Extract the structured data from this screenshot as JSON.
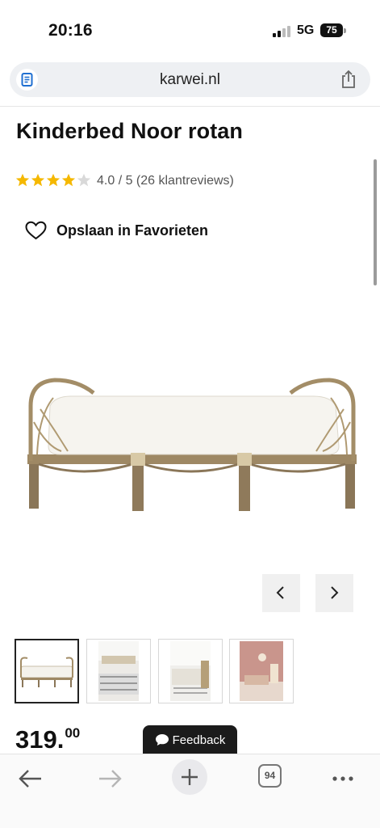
{
  "status_bar": {
    "time": "20:16",
    "network": "5G",
    "battery": "75"
  },
  "browser": {
    "url": "karwei.nl",
    "open_tabs": "94"
  },
  "product": {
    "title": "Kinderbed Noor rotan",
    "rating": {
      "stars": 4,
      "max_stars": 5,
      "text": "4.0 / 5 (26 klantreviews)"
    },
    "favorite_label": "Opslaan in Favorieten",
    "price_main": "319.",
    "price_cents": "00",
    "thumbnail_count": 4,
    "selected_thumbnail": 1
  },
  "feedback_label": "Feedback",
  "colors": {
    "star_filled": "#F5B800",
    "star_empty": "#D9D9D9",
    "nav_button_bg": "#F0F0F0",
    "feedback_bg": "#1B1B1B"
  },
  "icons": {
    "url_page": "page-icon",
    "share": "share-icon",
    "favorite": "heart-outline-icon",
    "prev": "chevron-left-icon",
    "next": "chevron-right-icon",
    "feedback": "chat-bubble-icon",
    "back": "arrow-left-icon",
    "forward": "arrow-right-icon",
    "new_tab": "plus-icon",
    "more": "ellipsis-icon"
  }
}
